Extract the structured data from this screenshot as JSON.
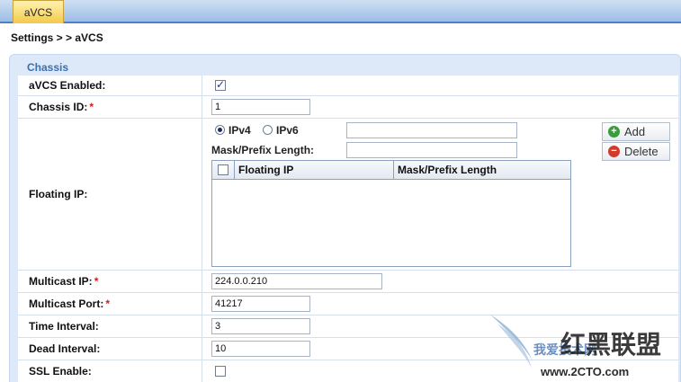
{
  "tab": {
    "label": "aVCS"
  },
  "breadcrumb": "Settings  > >  aVCS",
  "panel": {
    "title": "Chassis"
  },
  "form": {
    "avcs_enabled": {
      "label": "aVCS Enabled:",
      "checked": true
    },
    "chassis_id": {
      "label": "Chassis ID:",
      "required": "*",
      "value": "1"
    },
    "floating_ip": {
      "label": "Floating IP:",
      "ipv4_label": "IPv4",
      "ipv6_label": "IPv6",
      "selected": "IPv4",
      "ip_value": "",
      "mask_label": "Mask/Prefix Length:",
      "mask_value": "",
      "columns": [
        "Floating IP",
        "Mask/Prefix Length"
      ],
      "rows": [],
      "add_label": "Add",
      "delete_label": "Delete"
    },
    "multicast_ip": {
      "label": "Multicast IP:",
      "required": "*",
      "value": "224.0.0.210"
    },
    "multicast_port": {
      "label": "Multicast Port:",
      "required": "*",
      "value": "41217"
    },
    "time_interval": {
      "label": "Time Interval:",
      "value": "3"
    },
    "dead_interval": {
      "label": "Dead Interval:",
      "value": "10"
    },
    "ssl_enable": {
      "label": "SSL Enable:",
      "checked": false
    }
  },
  "watermark": {
    "cn_text": "红黑联盟",
    "sub_text": "我爱技术网",
    "url": "www.2CTO.com"
  },
  "colors": {
    "tab_active": "#f3c94a",
    "panel_bg": "#dde9f8",
    "title": "#3a6fb0",
    "required": "#d21b1b"
  },
  "icons": {
    "add": "plus-circle-icon",
    "delete": "minus-circle-icon"
  }
}
